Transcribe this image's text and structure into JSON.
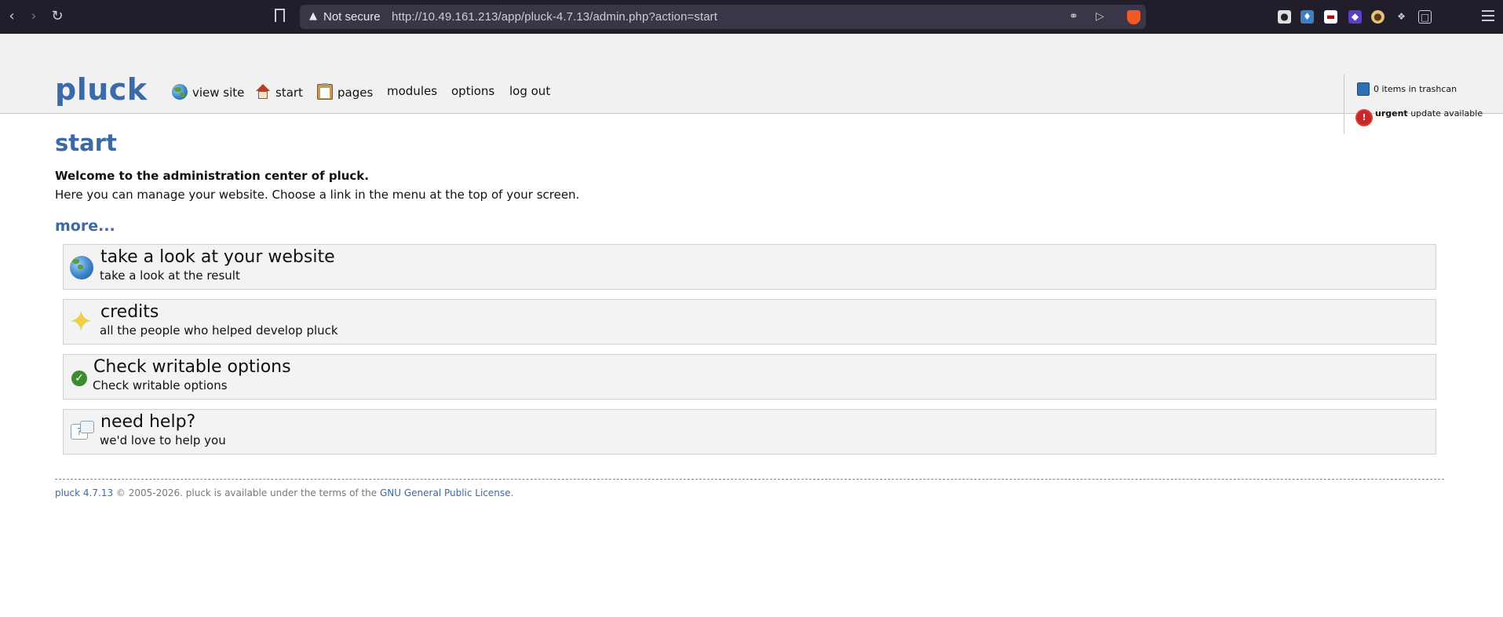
{
  "browser": {
    "security_label": "Not secure",
    "url": "http://10.49.161.213/app/pluck-4.7.13/admin.php?action=start"
  },
  "header": {
    "logo": "pluck",
    "nav": [
      {
        "label": "view site",
        "icon": "globe-icon"
      },
      {
        "label": "start",
        "icon": "home-icon"
      },
      {
        "label": "pages",
        "icon": "clipboard-icon"
      },
      {
        "label": "modules"
      },
      {
        "label": "options"
      },
      {
        "label": "log out"
      }
    ],
    "trash": "0 items in trashcan",
    "urgent_bold": "urgent",
    "urgent_rest": "update available"
  },
  "main": {
    "title": "start",
    "welcome": "Welcome to the administration center of pluck.",
    "intro": "Here you can manage your website. Choose a link in the menu at the top of your screen.",
    "more": "more...",
    "boxes": [
      {
        "title": "take a look at your website",
        "subtitle": "take a look at the result",
        "icon": "globe-icon"
      },
      {
        "title": "credits",
        "subtitle": "all the people who helped develop pluck",
        "icon": "star-icon"
      },
      {
        "title": "Check writable options",
        "subtitle": "Check writable options",
        "icon": "check-icon"
      },
      {
        "title": "need help?",
        "subtitle": "we'd love to help you",
        "icon": "help-icon"
      }
    ]
  },
  "footer": {
    "version": "pluck 4.7.13",
    "text": " © 2005-2026. pluck is available under the terms of the ",
    "license": "GNU General Public License",
    "end": "."
  },
  "colors": {
    "brand": "#3a6aa8",
    "header_bg": "#f1f1f1",
    "browser_bg": "#211d2b"
  }
}
